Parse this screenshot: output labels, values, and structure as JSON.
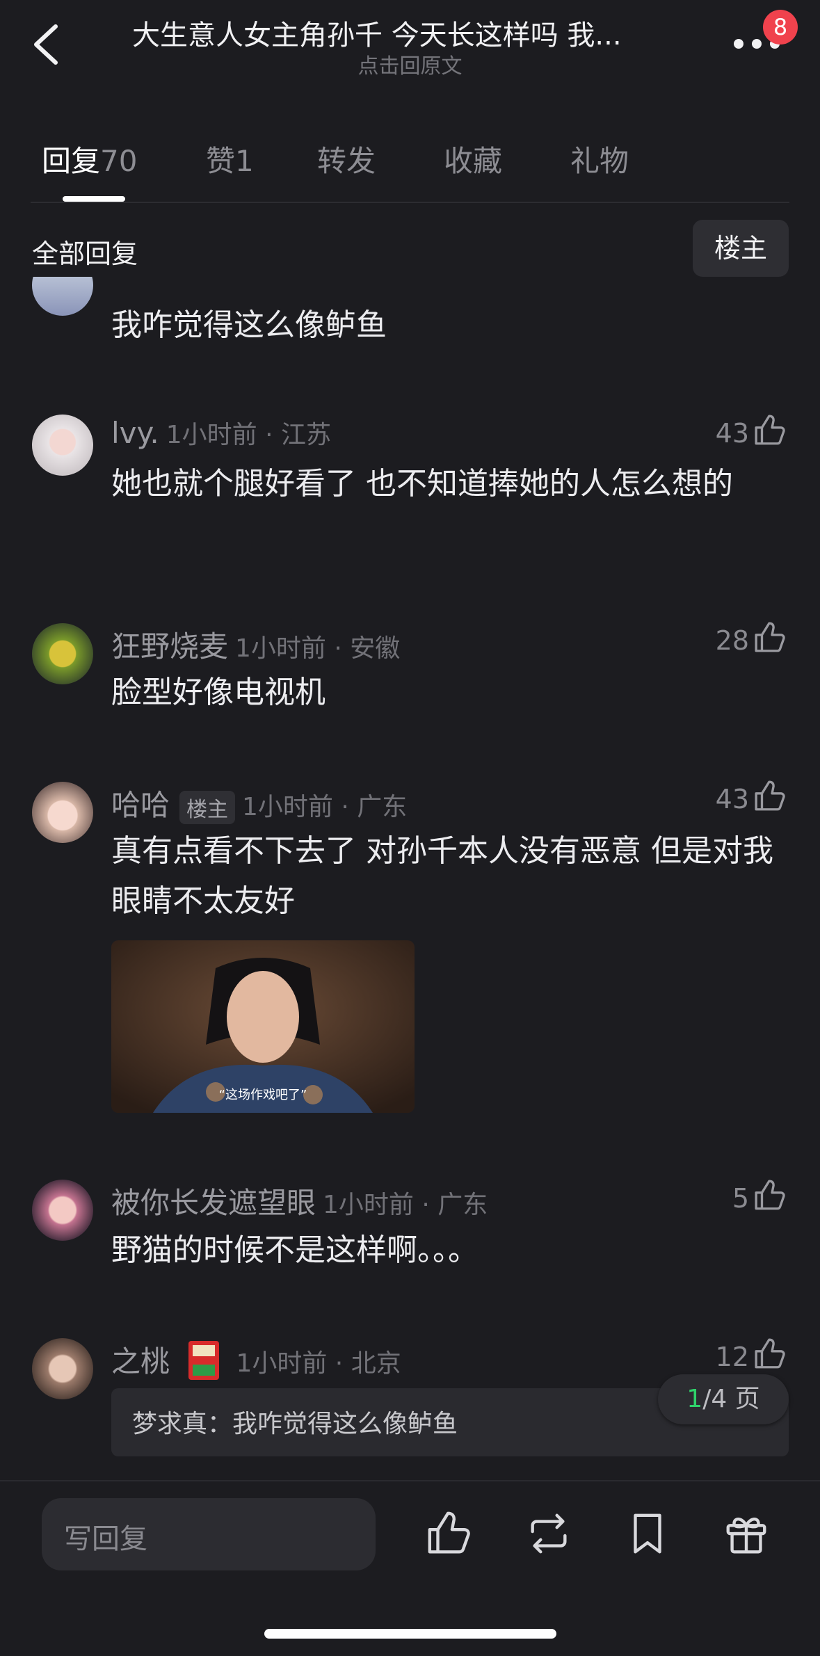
{
  "header": {
    "title": "大生意人女主角孙千  今天长这样吗 我...",
    "subtitle": "点击回原文",
    "badge": "8"
  },
  "tabs": [
    {
      "label": "回复",
      "count": "70"
    },
    {
      "label": "赞",
      "count": "1"
    },
    {
      "label": "转发",
      "count": ""
    },
    {
      "label": "收藏",
      "count": ""
    },
    {
      "label": "礼物",
      "count": ""
    }
  ],
  "filter": {
    "all": "全部回复",
    "op": "楼主"
  },
  "comments": [
    {
      "text": "我咋觉得这么像鲈鱼"
    },
    {
      "user": "lvy.",
      "meta": "1小时前 · 江苏",
      "likes": "43",
      "text": "她也就个腿好看了  也不知道捧她的人怎么想的"
    },
    {
      "user": "狂野烧麦",
      "meta": "1小时前 · 安徽",
      "likes": "28",
      "text": "脸型好像电视机"
    },
    {
      "user": "哈哈",
      "tag": "楼主",
      "meta": "1小时前 · 广东",
      "likes": "43",
      "text": "真有点看不下去了  对孙千本人没有恶意 但是对我眼睛不太友好",
      "image_caption": "“这场作戏吧了”"
    },
    {
      "user": "被你长发遮望眼",
      "meta": "1小时前 · 广东",
      "likes": "5",
      "text": "野猫的时候不是这样啊。。。"
    },
    {
      "user": "之桃",
      "meta": "1小时前 · 北京",
      "likes": "12",
      "quote": "梦求真：我咋觉得这么像鲈鱼"
    }
  ],
  "pager": {
    "current": "1",
    "total": "/4 页"
  },
  "bottom": {
    "placeholder": "写回复"
  },
  "icons": [
    "back-icon",
    "more-icon",
    "like-icon",
    "repost-icon",
    "bookmark-icon",
    "gift-icon"
  ],
  "colors": {
    "background": "#1c1c20",
    "accent_green": "#2fd16a",
    "badge_red": "#f0424d"
  }
}
